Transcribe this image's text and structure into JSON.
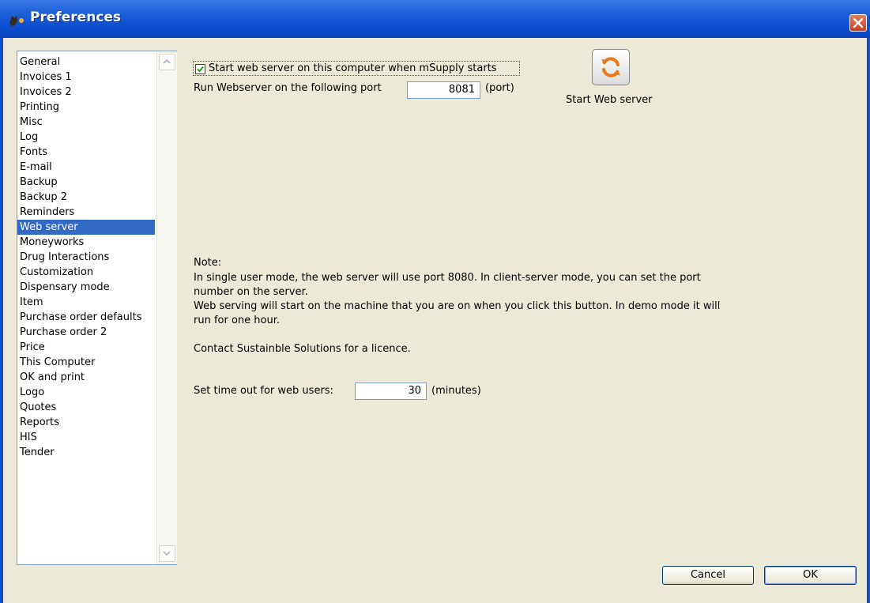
{
  "window": {
    "title": "Preferences",
    "colors": {
      "titlebar": "#0b4fd0",
      "selection": "#316ac5",
      "close": "#c9401c",
      "background": "#ece9d8"
    }
  },
  "sidebar": {
    "items": [
      {
        "label": "General"
      },
      {
        "label": "Invoices 1"
      },
      {
        "label": "Invoices 2"
      },
      {
        "label": "Printing"
      },
      {
        "label": "Misc"
      },
      {
        "label": "Log"
      },
      {
        "label": "Fonts"
      },
      {
        "label": "E-mail"
      },
      {
        "label": "Backup"
      },
      {
        "label": "Backup 2"
      },
      {
        "label": "Reminders"
      },
      {
        "label": "Web server",
        "selected": true
      },
      {
        "label": "Moneyworks"
      },
      {
        "label": "Drug Interactions"
      },
      {
        "label": "Customization"
      },
      {
        "label": "Dispensary mode"
      },
      {
        "label": "Item"
      },
      {
        "label": "Purchase order defaults"
      },
      {
        "label": "Purchase order 2"
      },
      {
        "label": "Price"
      },
      {
        "label": "This Computer"
      },
      {
        "label": "OK and print"
      },
      {
        "label": "Logo"
      },
      {
        "label": "Quotes"
      },
      {
        "label": "Reports"
      },
      {
        "label": "HIS"
      },
      {
        "label": "Tender"
      }
    ]
  },
  "webserver": {
    "start_checkbox_label": "Start web server on this computer when mSupply starts",
    "start_checkbox_checked": true,
    "port_label": "Run Webserver on the following port",
    "port_value": "8081",
    "port_unit": "(port)",
    "start_button_label": "Start Web server",
    "start_button_icon": "refresh-icon",
    "note_title": "Note:",
    "note_line1": "In single user mode, the web server will use port 8080. In client-server mode, you can set the port",
    "note_line2": "number on the server.",
    "note_line3": "Web serving will start on the machine that you are on when you click this button. In demo mode it will",
    "note_line4": "run for one hour.",
    "licence_text": "Contact Sustainble Solutions for a licence.",
    "timeout_label": "Set time out for web users:",
    "timeout_value": "30",
    "timeout_unit": "(minutes)"
  },
  "footer": {
    "cancel_label": "Cancel",
    "ok_label": "OK"
  }
}
